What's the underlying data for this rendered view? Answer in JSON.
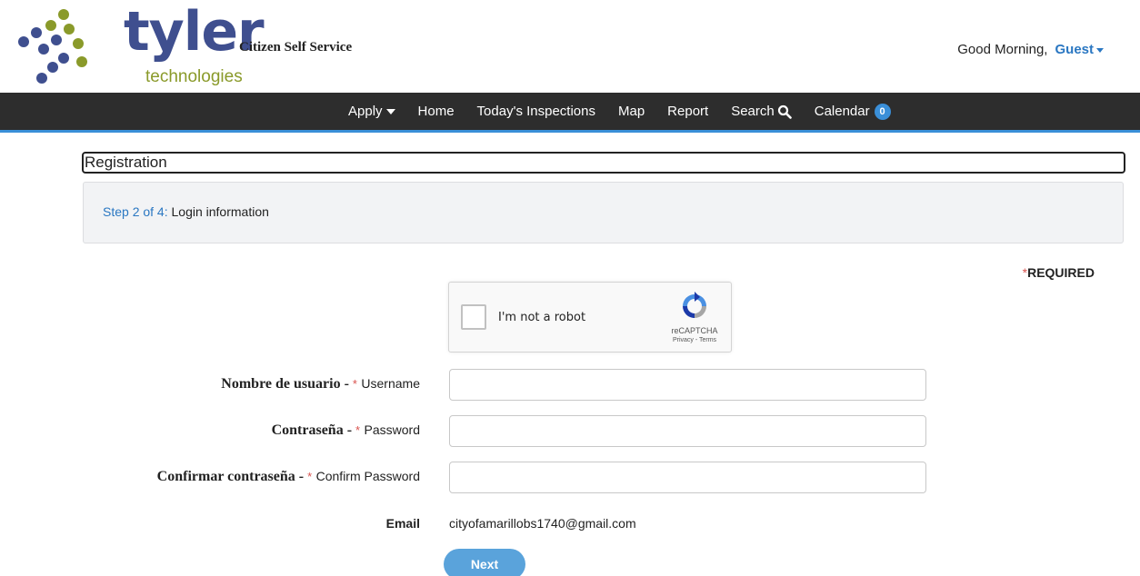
{
  "header": {
    "logo_word": "tyler",
    "logo_sub": "technologies",
    "app_title": "Citizen Self Service",
    "greeting": "Good Morning,",
    "user_name": "Guest"
  },
  "nav": {
    "items": [
      {
        "label": "Apply",
        "icon": "caret-down-icon"
      },
      {
        "label": "Home"
      },
      {
        "label": "Today's Inspections"
      },
      {
        "label": "Map"
      },
      {
        "label": "Report"
      },
      {
        "label": "Search",
        "icon": "search-icon"
      },
      {
        "label": "Calendar",
        "badge": "0"
      }
    ]
  },
  "registration": {
    "title": "Registration",
    "step_number": "Step 2 of 4:",
    "step_name": "Login information",
    "required_star": "*",
    "required_label": "REQUIRED"
  },
  "captcha": {
    "label": "I'm not a robot",
    "brand": "reCAPTCHA",
    "links": "Privacy - Terms"
  },
  "form": {
    "username": {
      "es": "Nombre de usuario - ",
      "star": "*",
      "en": "Username",
      "value": ""
    },
    "password": {
      "es": "Contraseña - ",
      "star": "*",
      "en": "Password",
      "value": ""
    },
    "confirm": {
      "es": "Confirmar contraseña - ",
      "star": "*",
      "en": "Confirm Password",
      "value": ""
    },
    "email_label": "Email",
    "email_value": "cityofamarillobs1740@gmail.com",
    "next_label": "Next"
  },
  "colors": {
    "nav_bg": "#2d2d2d",
    "accent": "#3a8fd8",
    "link": "#2a77c2",
    "required": "#d9534f",
    "logo_blue": "#3f4f8f",
    "logo_green": "#8a9a2a"
  }
}
